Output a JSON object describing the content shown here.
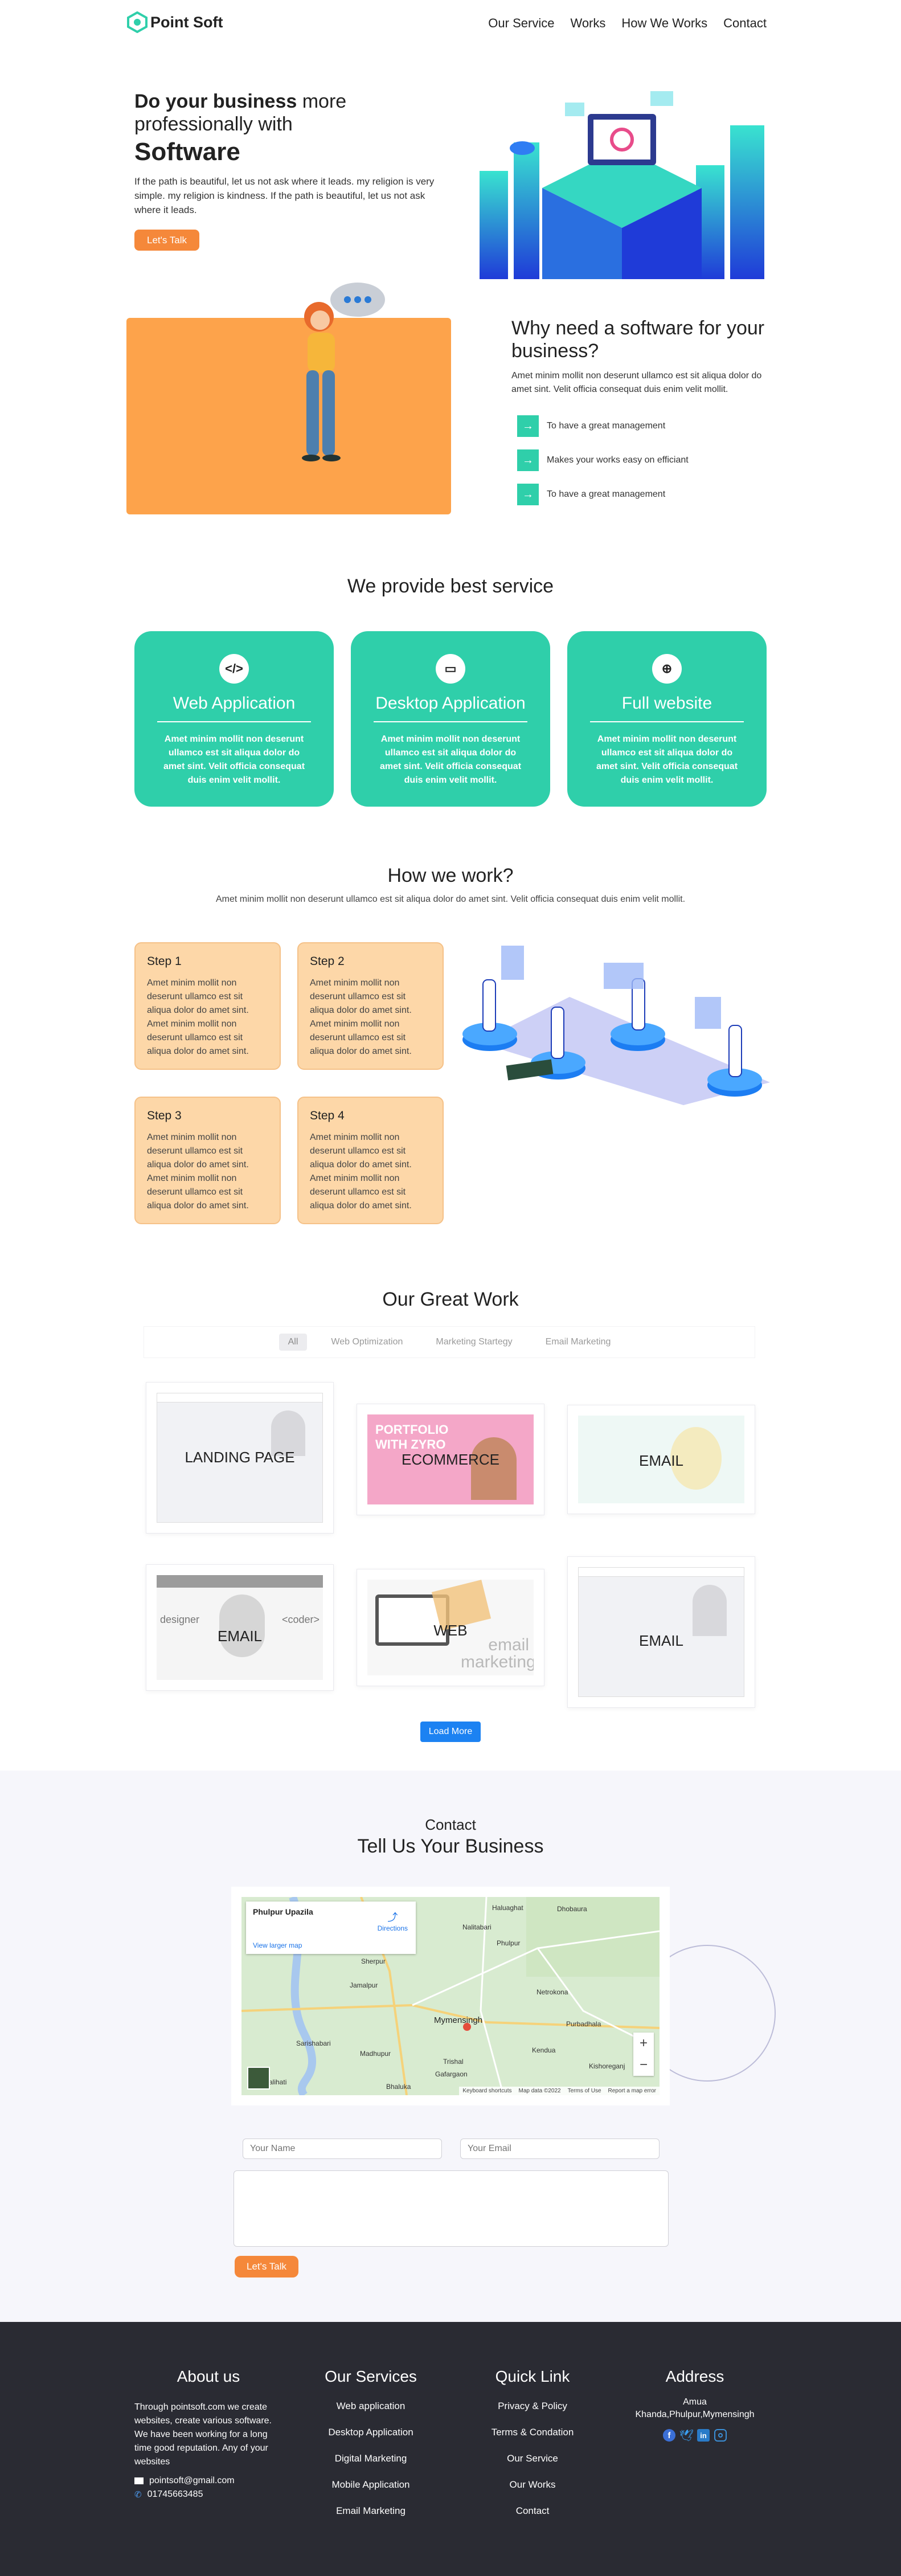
{
  "header": {
    "brand": "Point Soft",
    "nav": [
      "Our Service",
      "Works",
      "How We Works",
      "Contact"
    ]
  },
  "hero": {
    "title_bold": "Do your business",
    "title_rest": " more professionally with",
    "title_big": "Software",
    "body": "If the path is beautiful, let us not ask where it leads. my religion is very simple. my religion is kindness. If the path is beautiful, let us not ask where it leads.",
    "cta": "Let's Talk"
  },
  "why": {
    "title": "Why need a software for your business?",
    "body": "Amet minim mollit non deserunt ullamco est sit aliqua dolor do amet sint. Velit officia consequat duis enim velit mollit.",
    "items": [
      "To have a great management",
      "Makes your works easy on efficiant",
      "To have a great management"
    ]
  },
  "services": {
    "title": "We provide best service",
    "cards": [
      {
        "icon": "</>",
        "title": "Web Application",
        "body": "Amet minim mollit non deserunt ullamco est sit aliqua dolor do amet sint. Velit officia consequat duis enim velit mollit."
      },
      {
        "icon": "▭",
        "title": "Desktop Application",
        "body": "Amet minim mollit non deserunt ullamco est sit aliqua dolor do amet sint. Velit officia consequat duis enim velit mollit."
      },
      {
        "icon": "⊕",
        "title": "Full website",
        "body": "Amet minim mollit non deserunt ullamco est sit aliqua dolor do amet sint. Velit officia consequat duis enim velit mollit."
      }
    ]
  },
  "how": {
    "title": "How we work?",
    "subtitle": "Amet minim mollit non deserunt ullamco est sit aliqua dolor do amet sint. Velit officia consequat duis enim velit mollit.",
    "steps": [
      {
        "title": "Step 1",
        "body": "Amet minim mollit non deserunt ullamco est sit aliqua dolor do amet sint. Amet minim mollit non deserunt ullamco est sit aliqua dolor do amet sint."
      },
      {
        "title": "Step 2",
        "body": "Amet minim mollit non deserunt ullamco est sit aliqua dolor do amet sint. Amet minim mollit non deserunt ullamco est sit aliqua dolor do amet sint."
      },
      {
        "title": "Step 3",
        "body": "Amet minim mollit non deserunt ullamco est sit aliqua dolor do amet sint. Amet minim mollit non deserunt ullamco est sit aliqua dolor do amet sint."
      },
      {
        "title": "Step 4",
        "body": "Amet minim mollit non deserunt ullamco est sit aliqua dolor do amet sint. Amet minim mollit non deserunt ullamco est sit aliqua dolor do amet sint."
      }
    ]
  },
  "works": {
    "title": "Our Great Work",
    "tabs": [
      "All",
      "Web Optimization",
      "Marketing Startegy",
      "Email Marketing"
    ],
    "items": [
      "LANDING PAGE",
      "ECOMMERCE",
      "EMAIL",
      "EMAIL",
      "WEB",
      "EMAIL"
    ],
    "thumb_text": {
      "designer": "designer",
      "coder": "<coder>",
      "portfolio": "PORTFOLIO WITH ZYRO",
      "email_marketing": "email marketing"
    },
    "load_more": "Load More"
  },
  "contact": {
    "kicker": "Contact",
    "title": "Tell Us Your Business",
    "map": {
      "place": "Phulpur Upazila",
      "directions": "Directions",
      "larger": "View larger map",
      "labels": [
        "Sherpur",
        "Nalitabari",
        "Haluaghat",
        "Dhobaura",
        "Jamalpur",
        "Phulpur",
        "Mymensingh",
        "Netrokona",
        "Purbadhala",
        "Kendua",
        "Trishal",
        "Gafargaon",
        "Kishoreganj",
        "Sarishabari",
        "Madhupur",
        "Kalihati",
        "Bhaluka"
      ],
      "footer": [
        "Keyboard shortcuts",
        "Map data ©2022",
        "Terms of Use",
        "Report a map error"
      ]
    },
    "name_placeholder": "Your Name",
    "email_placeholder": "Your Email",
    "cta": "Let's Talk"
  },
  "footer": {
    "about": {
      "title": "About us",
      "body": "Through pointsoft.com we create websites, create various software. We have been working for a long time good reputation. Any of your websites",
      "email": "pointsoft@gmail.com",
      "phone": "01745663485"
    },
    "services": {
      "title": "Our Services",
      "items": [
        "Web application",
        "Desktop Application",
        "Digital Marketing",
        "Mobile Application",
        "Email Marketing"
      ]
    },
    "quick": {
      "title": "Quick Link",
      "items": [
        "Privacy & Policy",
        "Terms & Condation",
        "Our Service",
        "Our Works",
        "Contact"
      ]
    },
    "address": {
      "title": "Address",
      "lines": [
        "Amua",
        "Khanda,Phulpur,Mymensingh"
      ]
    }
  },
  "colors": {
    "brand": "#2fcfaa",
    "orange": "#f5883a",
    "footer": "#2a2b33",
    "blue": "#1c82f2"
  }
}
